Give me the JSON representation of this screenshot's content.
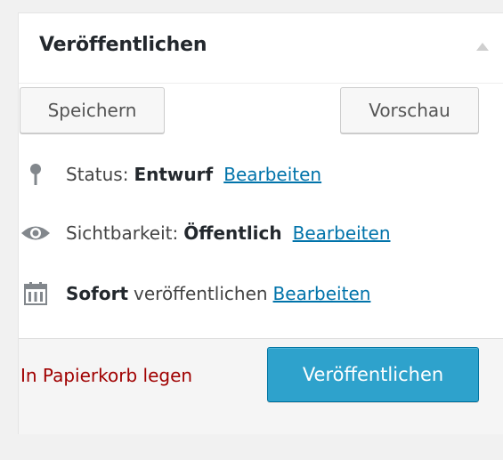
{
  "box": {
    "title": "Veröffentlichen"
  },
  "buttons": {
    "save": "Speichern",
    "preview": "Vorschau",
    "publish": "Veröffentlichen"
  },
  "status": {
    "label": "Status:",
    "value": "Entwurf",
    "edit": "Bearbeiten"
  },
  "visibility": {
    "label": "Sichtbarkeit:",
    "value": "Öffentlich",
    "edit": "Bearbeiten"
  },
  "schedule": {
    "value": "Sofort",
    "label": "veröffentlichen",
    "edit": "Bearbeiten"
  },
  "trash": {
    "label": "In Papierkorb legen"
  },
  "colors": {
    "accent": "#2ea2cc",
    "link": "#0073aa",
    "trash": "#a00000"
  }
}
